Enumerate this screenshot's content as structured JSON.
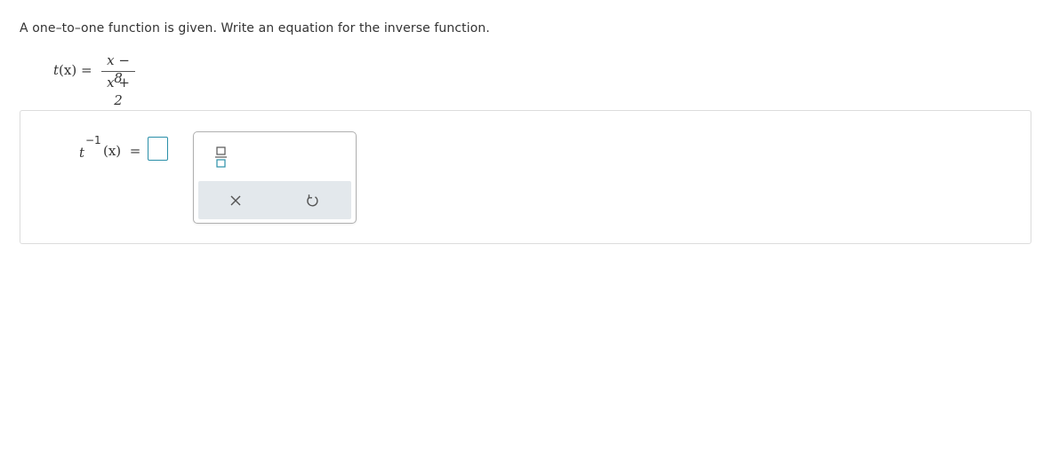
{
  "prompt": {
    "text": "A one–to–one function is given. Write an equation for the inverse function."
  },
  "given_function": {
    "name": "t",
    "argument": "(x)",
    "equals": "=",
    "numerator": "x − 8",
    "denominator": "x + 2"
  },
  "answer": {
    "function_name": "t",
    "superscript": "−1",
    "argument": "(x)",
    "equals": "=",
    "input_value": ""
  },
  "palette": {
    "fraction_tool_icon": "fraction-template-icon",
    "clear_icon": "close-x-icon",
    "undo_icon": "undo-icon"
  },
  "colors": {
    "accent": "#2a8fa8",
    "toolbar_bg": "#e3e8ec",
    "text": "#333333",
    "border": "#dcdcdc"
  }
}
